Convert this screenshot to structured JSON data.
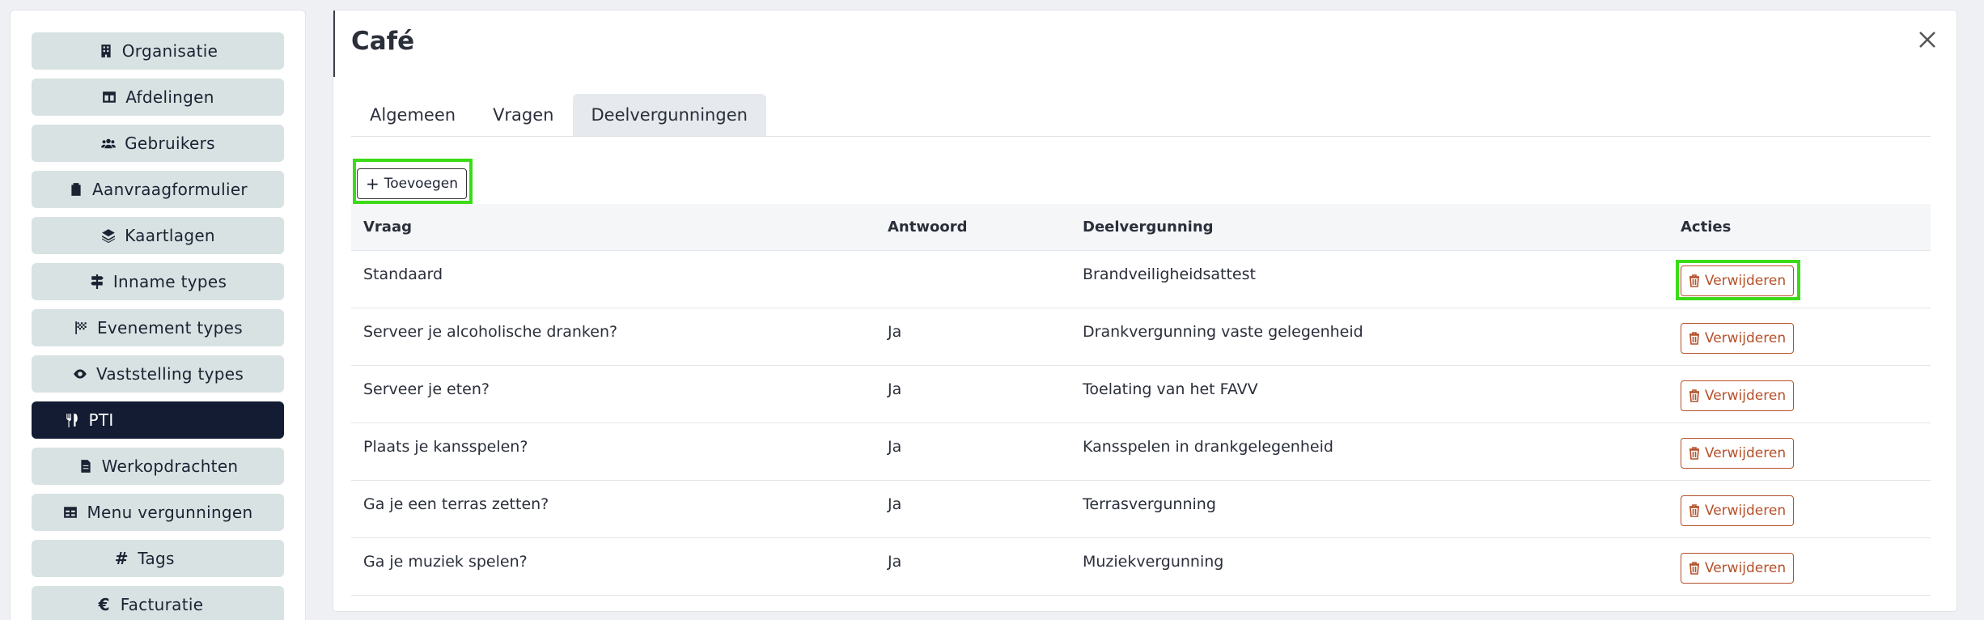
{
  "sidebar": {
    "items": [
      {
        "label": "Organisatie",
        "icon": "building-icon"
      },
      {
        "label": "Afdelingen",
        "icon": "table-layout-icon"
      },
      {
        "label": "Gebruikers",
        "icon": "users-icon"
      },
      {
        "label": "Aanvraagformulier",
        "icon": "clipboard-icon"
      },
      {
        "label": "Kaartlagen",
        "icon": "layers-icon"
      },
      {
        "label": "Inname types",
        "icon": "signpost-icon"
      },
      {
        "label": "Evenement types",
        "icon": "flag-checkered-icon"
      },
      {
        "label": "Vaststelling types",
        "icon": "eye-icon"
      },
      {
        "label": "PTI",
        "icon": "utensils-icon",
        "active": true
      },
      {
        "label": "Werkopdrachten",
        "icon": "file-icon"
      },
      {
        "label": "Menu vergunningen",
        "icon": "grid-table-icon"
      },
      {
        "label": "Tags",
        "icon": "hash-icon"
      },
      {
        "label": "Facturatie",
        "icon": "euro-icon"
      }
    ]
  },
  "panel": {
    "title": "Café",
    "tabs": [
      {
        "label": "Algemeen"
      },
      {
        "label": "Vragen"
      },
      {
        "label": "Deelvergunningen",
        "active": true
      }
    ],
    "add_label": "Toevoegen"
  },
  "table": {
    "headers": [
      "Vraag",
      "Antwoord",
      "Deelvergunning",
      "Acties"
    ],
    "rows": [
      {
        "vraag": "Standaard",
        "antwoord": "",
        "deelvergunning": "Brandveiligheidsattest",
        "action": "Verwijderen"
      },
      {
        "vraag": "Serveer je alcoholische dranken?",
        "antwoord": "Ja",
        "deelvergunning": "Drankvergunning vaste gelegenheid",
        "action": "Verwijderen"
      },
      {
        "vraag": "Serveer je eten?",
        "antwoord": "Ja",
        "deelvergunning": "Toelating van het FAVV",
        "action": "Verwijderen"
      },
      {
        "vraag": "Plaats je kansspelen?",
        "antwoord": "Ja",
        "deelvergunning": "Kansspelen in drankgelegenheid",
        "action": "Verwijderen"
      },
      {
        "vraag": "Ga je een terras zetten?",
        "antwoord": "Ja",
        "deelvergunning": "Terrasvergunning",
        "action": "Verwijderen"
      },
      {
        "vraag": "Ga je muziek spelen?",
        "antwoord": "Ja",
        "deelvergunning": "Muziekvergunning",
        "action": "Verwijderen"
      }
    ]
  },
  "colors": {
    "sidebar_item_bg": "#d8e2e3",
    "sidebar_active_bg": "#141c33",
    "highlight": "#3bdc17",
    "danger": "#b5502a"
  }
}
